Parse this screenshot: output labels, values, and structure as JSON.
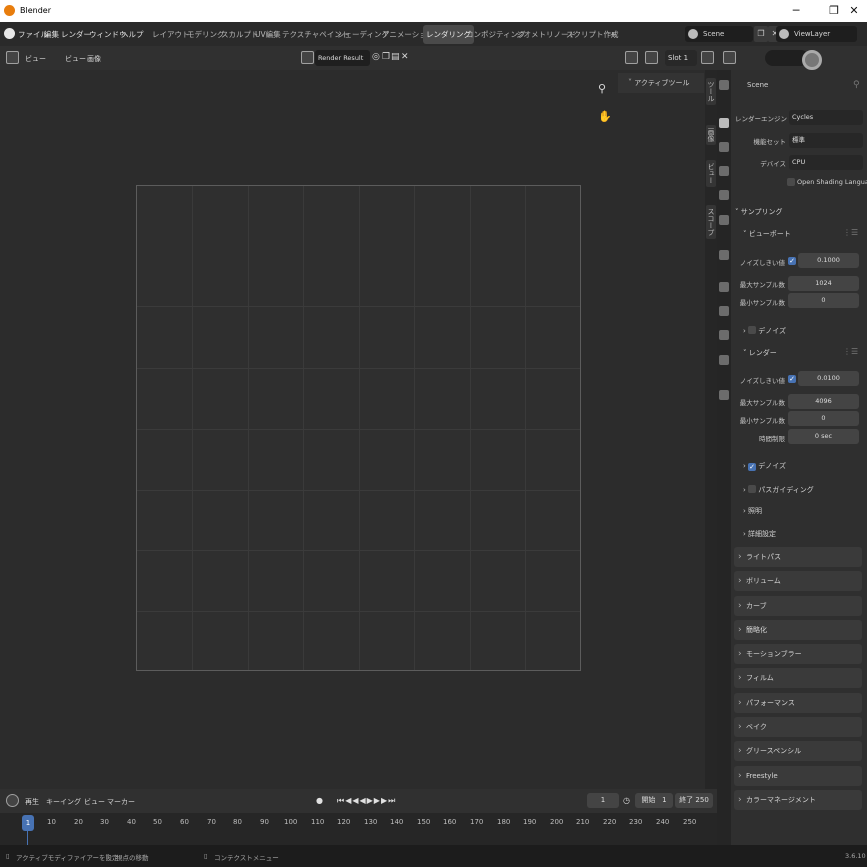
{
  "window": {
    "title": "Blender",
    "minimize": "─",
    "maximize": "❐",
    "close": "✕"
  },
  "menu": [
    "ファイル",
    "編集",
    "レンダー",
    "ウィンドウ",
    "ヘルプ"
  ],
  "workspaces": [
    "レイアウト",
    "モデリング",
    "スカルプト",
    "UV編集",
    "テクスチャペイント",
    "シェーディング",
    "アニメーション",
    "レンダリング",
    "コンポジティング",
    "ジオメトリノード",
    "スクリプト作成",
    "+"
  ],
  "active_workspace": "レンダリング",
  "scene": {
    "name": "Scene",
    "view_layer": "ViewLayer"
  },
  "image_editor": {
    "view_mode": "ビュー",
    "menus": [
      "ビュー",
      "画像"
    ],
    "image_name": "Render Result",
    "slot": "Slot 1",
    "tool_panel_title": "アクティブツール",
    "side_tabs": [
      "ツール",
      "画像",
      "ビュー",
      "スコープ"
    ]
  },
  "properties": {
    "context": "Scene",
    "render_engine_label": "レンダーエンジン",
    "render_engine": "Cycles",
    "feature_set_label": "機能セット",
    "feature_set": "標準",
    "device_label": "デバイス",
    "device": "CPU",
    "osl_label": "Open Shading Language",
    "sampling": "サンプリング",
    "viewport": "ビューポート",
    "noise_threshold_label": "ノイズしきい値",
    "vp_noise_threshold": "0.1000",
    "max_samples_label": "最大サンプル数",
    "vp_max_samples": "1024",
    "min_samples_label": "最小サンプル数",
    "vp_min_samples": "0",
    "denoise": "デノイズ",
    "render": "レンダー",
    "r_noise_threshold": "0.0100",
    "r_max_samples": "4096",
    "r_min_samples": "0",
    "time_limit_label": "時間制限",
    "time_limit": "0 sec",
    "path_guiding": "パスガイディング",
    "lights": "照明",
    "advanced": "詳細設定",
    "panels": [
      "ライトパス",
      "ボリューム",
      "カーブ",
      "簡略化",
      "モーションブラー",
      "フィルム",
      "パフォーマンス",
      "ベイク",
      "グリースペンシル",
      "Freestyle",
      "カラーマネージメント"
    ]
  },
  "timeline": {
    "menus": [
      "再生",
      "キーイング",
      "ビュー",
      "マーカー"
    ],
    "current_frame": "1",
    "start_label": "開始",
    "start": "1",
    "end_label": "終了",
    "end": "250",
    "ruler": [
      "10",
      "20",
      "30",
      "40",
      "50",
      "60",
      "70",
      "80",
      "90",
      "100",
      "110",
      "120",
      "130",
      "140",
      "150",
      "160",
      "170",
      "180",
      "190",
      "200",
      "210",
      "220",
      "230",
      "240",
      "250"
    ]
  },
  "status": {
    "left": "アクティブモディファイアーを設定",
    "middle": "視点の移動",
    "right": "コンテクストメニュー",
    "version": "3.6.10"
  }
}
